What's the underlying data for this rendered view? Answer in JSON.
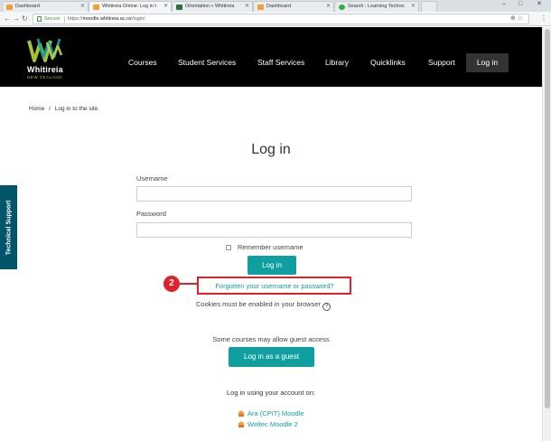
{
  "browser": {
    "tabs": [
      {
        "label": "Dashboard",
        "color": "#f0a13a"
      },
      {
        "label": "Whitireia Online: Log in t",
        "color": "#f0a13a"
      },
      {
        "label": "Orientation » Whitireia",
        "color": "#2f6f3f"
      },
      {
        "label": "Dashboard",
        "color": "#f0a13a"
      },
      {
        "label": "Search : Learning Techno",
        "color": "#2ab04a"
      }
    ],
    "secure_label": "Secure",
    "url_prefix": "https://",
    "url_host": "moodle.whitireia.ac.nz",
    "url_path": "/login/"
  },
  "header": {
    "logo_text": "Whitireia",
    "logo_sub": "NEW ZEALAND",
    "nav": [
      "Courses",
      "Student Services",
      "Staff Services",
      "Library",
      "Quicklinks",
      "Support"
    ],
    "login_button": "Log in"
  },
  "breadcrumb": {
    "home": "Home",
    "separator": "/",
    "current": "Log in to the site"
  },
  "side_tab": {
    "label": "Technical Support",
    "color": "#00556b"
  },
  "form": {
    "title": "Log in",
    "username_label": "Username",
    "username_value": "",
    "password_label": "Password",
    "password_value": "",
    "remember_label": "Remember username",
    "submit_label": "Log in",
    "forgot_link": "Forgotten your username or password?",
    "cookies_note": "Cookies must be enabled in your browser",
    "help_icon": "?",
    "guest_note": "Some courses may allow guest access",
    "guest_button": "Log in as a guest",
    "accounts_heading": "Log in using your account on:",
    "providers": [
      "Ara (CPIT) Moodle",
      "Weltec Moodle 2"
    ]
  },
  "annotation": {
    "step": "2",
    "color": "#e0222b"
  },
  "accent_color": "#0f9fa1"
}
